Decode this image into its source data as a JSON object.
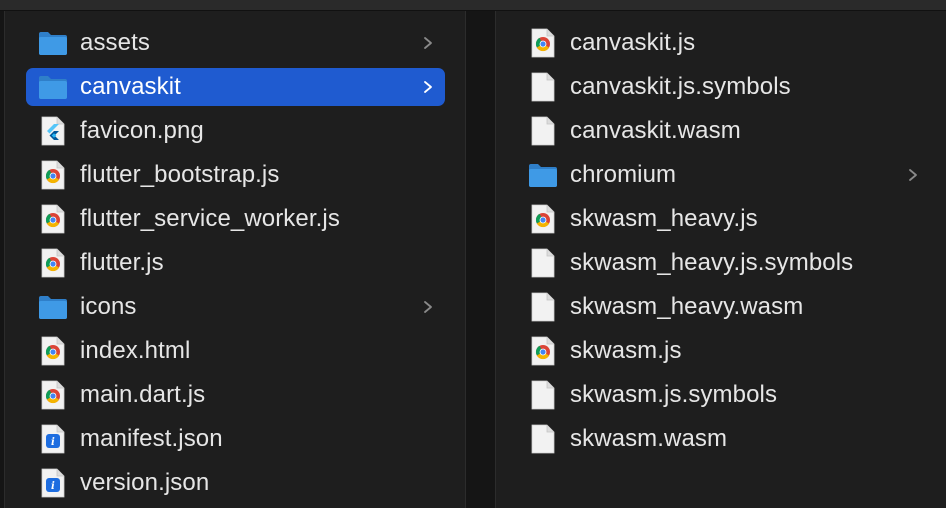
{
  "colors": {
    "background": "#1e1e1e",
    "selection": "#1f5bd0",
    "text": "#e6e6e6",
    "folder": "#3f9ae6"
  },
  "left_column": {
    "items": [
      {
        "label": "assets",
        "icon": "folder-icon",
        "has_children": true,
        "selected": false
      },
      {
        "label": "canvaskit",
        "icon": "folder-icon",
        "has_children": true,
        "selected": true
      },
      {
        "label": "favicon.png",
        "icon": "flutter-image-icon",
        "has_children": false,
        "selected": false
      },
      {
        "label": "flutter_bootstrap.js",
        "icon": "chrome-doc-icon",
        "has_children": false,
        "selected": false
      },
      {
        "label": "flutter_service_worker.js",
        "icon": "chrome-doc-icon",
        "has_children": false,
        "selected": false
      },
      {
        "label": "flutter.js",
        "icon": "chrome-doc-icon",
        "has_children": false,
        "selected": false
      },
      {
        "label": "icons",
        "icon": "folder-icon",
        "has_children": true,
        "selected": false
      },
      {
        "label": "index.html",
        "icon": "chrome-doc-icon",
        "has_children": false,
        "selected": false
      },
      {
        "label": "main.dart.js",
        "icon": "chrome-doc-icon",
        "has_children": false,
        "selected": false
      },
      {
        "label": "manifest.json",
        "icon": "json-doc-icon",
        "has_children": false,
        "selected": false
      },
      {
        "label": "version.json",
        "icon": "json-doc-icon",
        "has_children": false,
        "selected": false
      }
    ]
  },
  "right_column": {
    "items": [
      {
        "label": "canvaskit.js",
        "icon": "chrome-doc-icon",
        "has_children": false
      },
      {
        "label": "canvaskit.js.symbols",
        "icon": "blank-doc-icon",
        "has_children": false
      },
      {
        "label": "canvaskit.wasm",
        "icon": "blank-doc-icon",
        "has_children": false
      },
      {
        "label": "chromium",
        "icon": "folder-icon",
        "has_children": true
      },
      {
        "label": "skwasm_heavy.js",
        "icon": "chrome-doc-icon",
        "has_children": false
      },
      {
        "label": "skwasm_heavy.js.symbols",
        "icon": "blank-doc-icon",
        "has_children": false
      },
      {
        "label": "skwasm_heavy.wasm",
        "icon": "blank-doc-icon",
        "has_children": false
      },
      {
        "label": "skwasm.js",
        "icon": "chrome-doc-icon",
        "has_children": false
      },
      {
        "label": "skwasm.js.symbols",
        "icon": "blank-doc-icon",
        "has_children": false
      },
      {
        "label": "skwasm.wasm",
        "icon": "blank-doc-icon",
        "has_children": false
      }
    ]
  }
}
